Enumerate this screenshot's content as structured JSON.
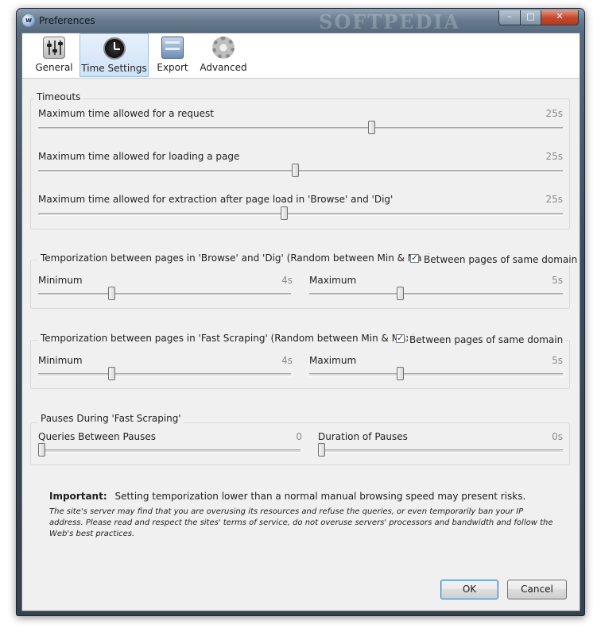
{
  "window": {
    "title": "Preferences",
    "app_icon": "app-logo-icon",
    "watermark": "SOFTPEDIA"
  },
  "toolbar": {
    "tabs": [
      {
        "label": "General",
        "icon": "sliders-icon",
        "active": false
      },
      {
        "label": "Time Settings",
        "icon": "clock-icon",
        "active": true
      },
      {
        "label": "Export",
        "icon": "cabinet-icon",
        "active": false
      },
      {
        "label": "Advanced",
        "icon": "gear-icon",
        "active": false
      }
    ]
  },
  "timeouts": {
    "title": "Timeouts",
    "sliders": [
      {
        "label": "Maximum time allowed for a request",
        "value": "25s",
        "level": 0.63
      },
      {
        "label": "Maximum time allowed for loading a page",
        "value": "25s",
        "level": 0.49
      },
      {
        "label": "Maximum time allowed for extraction after page load in 'Browse' and 'Dig'",
        "value": "25s",
        "level": 0.47
      }
    ]
  },
  "browse_dig": {
    "title": "Temporization between pages in 'Browse' and 'Dig' (Random between Min & Max)",
    "checkbox_label": "Between pages of same domain",
    "checked": true,
    "min": {
      "label": "Minimum",
      "value": "4s"
    },
    "max": {
      "label": "Maximum",
      "value": "5s"
    }
  },
  "fast_scraping": {
    "title": "Temporization between pages in 'Fast Scraping' (Random between Min & Max)",
    "checkbox_label": "Between pages of same domain",
    "checked": true,
    "min": {
      "label": "Minimum",
      "value": "4s"
    },
    "max": {
      "label": "Maximum",
      "value": "5s"
    }
  },
  "pauses": {
    "title": "Pauses During 'Fast Scraping'",
    "queries": {
      "label": "Queries Between Pauses",
      "value": "0"
    },
    "duration": {
      "label": "Duration of Pauses",
      "value": "0s"
    }
  },
  "notice": {
    "important_label": "Important:",
    "important_text": "Setting temporization lower than a normal manual browsing speed may present risks.",
    "warning": "The site's server may find that you are overusing its resources and refuse the queries, or even temporarily ban your IP address. Please read and respect the sites' terms of service, do not overuse servers' processors and bandwidth and follow the Web's best practices."
  },
  "buttons": {
    "ok": "OK",
    "cancel": "Cancel"
  }
}
